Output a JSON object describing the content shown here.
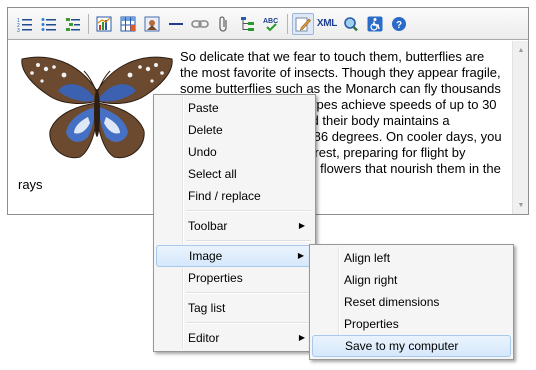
{
  "toolbar": {
    "buttons": [
      {
        "name": "numbered-list-icon"
      },
      {
        "name": "bulleted-list-icon"
      },
      {
        "name": "outdent-list-icon"
      },
      {
        "name": "insert-chart-icon"
      },
      {
        "name": "insert-table-icon"
      },
      {
        "name": "insert-image-icon"
      },
      {
        "name": "horizontal-rule-icon"
      },
      {
        "name": "link-icon"
      },
      {
        "name": "attachment-icon"
      },
      {
        "name": "tree-icon"
      },
      {
        "name": "spellcheck-icon"
      },
      {
        "name": "edit-pencil-icon"
      },
      {
        "name": "xml-icon",
        "label": "XML"
      },
      {
        "name": "zoom-icon"
      },
      {
        "name": "accessibility-icon"
      },
      {
        "name": "help-icon"
      }
    ]
  },
  "content": {
    "lines": [
      "So delicate that we fear to touch them, butterflies are",
      "the most favorite of insects. Though they appear fragile,",
      "some butterflies such as the Monarch can fly",
      "thousands of miles. Also, certain types achieve speeds",
      "of up to 30 miles per hour, provided their body maintains",
      "a temperature of at least 86 degrees. On cooler days,",
      "you might see butterflies at rest, preparing",
      "for flight by warming themselves on flowers that nourish them in the rays"
    ]
  },
  "context_menu": {
    "items": [
      {
        "label": "Paste"
      },
      {
        "label": "Delete"
      },
      {
        "label": "Undo"
      },
      {
        "label": "Select all"
      },
      {
        "label": "Find / replace"
      }
    ],
    "toolbar_label": "Toolbar",
    "image_label": "Image",
    "properties_label": "Properties",
    "tag_list_label": "Tag list",
    "editor_label": "Editor"
  },
  "image_submenu": {
    "items": [
      {
        "label": "Align left"
      },
      {
        "label": "Align right"
      },
      {
        "label": "Reset dimensions"
      },
      {
        "label": "Properties"
      },
      {
        "label": "Save to my computer"
      }
    ]
  },
  "colors": {
    "highlight": "#d6e8fb",
    "menu_bg": "#f5f5f5",
    "toolbar_bg": "#ececec"
  }
}
